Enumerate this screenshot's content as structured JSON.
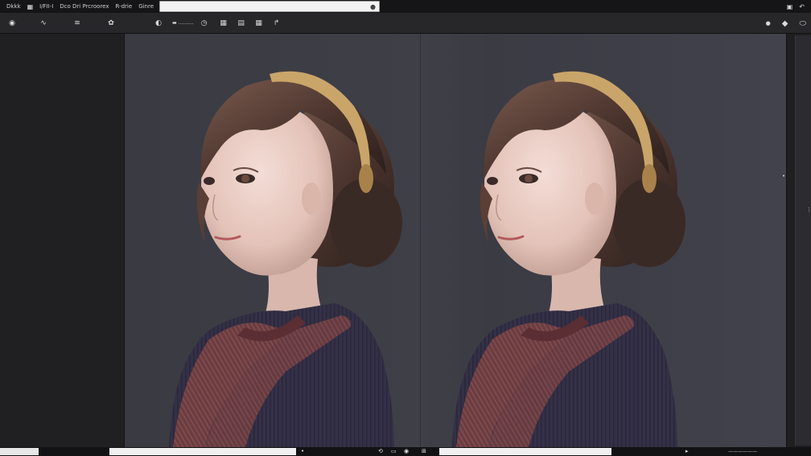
{
  "menubar": {
    "items": [
      {
        "label": "Dkkk",
        "icon": "grid"
      },
      {
        "label": "I/FII-I"
      },
      {
        "label": "Dco Dri Prcroorex"
      },
      {
        "label": "R-drie"
      },
      {
        "label": "Ginre"
      }
    ],
    "url_value": "",
    "url_icon": "●",
    "right_icons": [
      "window-icon",
      "undo-icon"
    ]
  },
  "toolbar": {
    "left_glyphs": [
      "◉",
      "∿",
      "≋",
      "✿"
    ],
    "mid_label": "▬ ..........",
    "mid_glyphs": [
      "◷",
      "▦",
      "▤",
      "▦",
      "↱"
    ],
    "right_icons": [
      "circle-dot-icon",
      "diamond-icon",
      "settings-icon"
    ]
  },
  "canvas": {
    "panels": [
      "left",
      "right"
    ]
  },
  "statusbar": {
    "left_text": "",
    "right_text": "——————",
    "icons": [
      "⟲",
      "▭",
      "◉",
      "⊞",
      "▸"
    ]
  }
}
